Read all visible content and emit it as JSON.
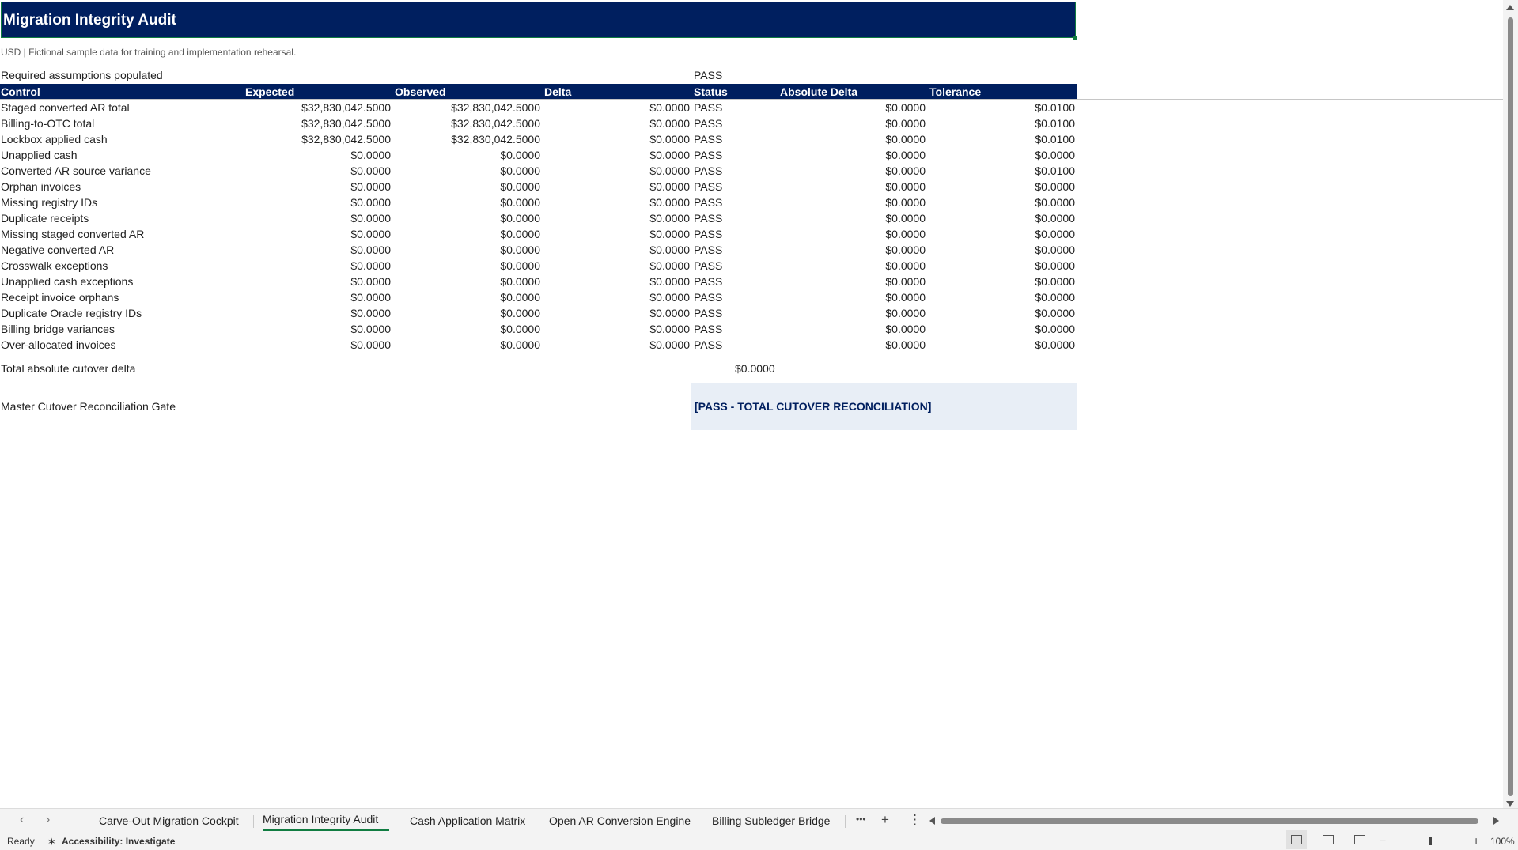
{
  "sheet": {
    "title": "Migration Integrity Audit",
    "note": "USD | Fictional sample data for training and implementation rehearsal.",
    "required": {
      "label": "Required assumptions populated",
      "value": "PASS"
    },
    "headers": [
      "Control",
      "Expected",
      "Observed",
      "Delta",
      "Status",
      "Absolute Delta",
      "Tolerance"
    ],
    "rows": [
      [
        "Staged converted AR total",
        "$32,830,042.5000",
        "$32,830,042.5000",
        "$0.0000",
        "PASS",
        "$0.0000",
        "$0.0100"
      ],
      [
        "Billing-to-OTC total",
        "$32,830,042.5000",
        "$32,830,042.5000",
        "$0.0000",
        "PASS",
        "$0.0000",
        "$0.0100"
      ],
      [
        "Lockbox applied cash",
        "$32,830,042.5000",
        "$32,830,042.5000",
        "$0.0000",
        "PASS",
        "$0.0000",
        "$0.0100"
      ],
      [
        "Unapplied cash",
        "$0.0000",
        "$0.0000",
        "$0.0000",
        "PASS",
        "$0.0000",
        "$0.0000"
      ],
      [
        "Converted AR source variance",
        "$0.0000",
        "$0.0000",
        "$0.0000",
        "PASS",
        "$0.0000",
        "$0.0100"
      ],
      [
        "Orphan invoices",
        "$0.0000",
        "$0.0000",
        "$0.0000",
        "PASS",
        "$0.0000",
        "$0.0000"
      ],
      [
        "Missing registry IDs",
        "$0.0000",
        "$0.0000",
        "$0.0000",
        "PASS",
        "$0.0000",
        "$0.0000"
      ],
      [
        "Duplicate receipts",
        "$0.0000",
        "$0.0000",
        "$0.0000",
        "PASS",
        "$0.0000",
        "$0.0000"
      ],
      [
        "Missing staged converted AR",
        "$0.0000",
        "$0.0000",
        "$0.0000",
        "PASS",
        "$0.0000",
        "$0.0000"
      ],
      [
        "Negative converted AR",
        "$0.0000",
        "$0.0000",
        "$0.0000",
        "PASS",
        "$0.0000",
        "$0.0000"
      ],
      [
        "Crosswalk exceptions",
        "$0.0000",
        "$0.0000",
        "$0.0000",
        "PASS",
        "$0.0000",
        "$0.0000"
      ],
      [
        "Unapplied cash exceptions",
        "$0.0000",
        "$0.0000",
        "$0.0000",
        "PASS",
        "$0.0000",
        "$0.0000"
      ],
      [
        "Receipt invoice orphans",
        "$0.0000",
        "$0.0000",
        "$0.0000",
        "PASS",
        "$0.0000",
        "$0.0000"
      ],
      [
        "Duplicate Oracle registry IDs",
        "$0.0000",
        "$0.0000",
        "$0.0000",
        "PASS",
        "$0.0000",
        "$0.0000"
      ],
      [
        "Billing bridge variances",
        "$0.0000",
        "$0.0000",
        "$0.0000",
        "PASS",
        "$0.0000",
        "$0.0000"
      ],
      [
        "Over-allocated invoices",
        "$0.0000",
        "$0.0000",
        "$0.0000",
        "PASS",
        "$0.0000",
        "$0.0000"
      ]
    ],
    "total": {
      "label": "Total absolute cutover delta",
      "value": "$0.0000"
    },
    "gate": {
      "label": "Master Cutover Reconciliation Gate",
      "value": "[PASS - TOTAL CUTOVER RECONCILIATION]"
    }
  },
  "tabs": {
    "items": [
      "Carve-Out Migration Cockpit",
      "Migration Integrity Audit",
      "Cash Application Matrix",
      "Open AR Conversion Engine",
      "Billing Subledger Bridge"
    ],
    "active_index": 1,
    "more": "•••",
    "add": "+",
    "options": "⋮"
  },
  "status": {
    "ready": "Ready",
    "accessibility": "Accessibility: Investigate",
    "zoom": "100%",
    "zoom_minus": "−",
    "zoom_plus": "+"
  },
  "colors": {
    "header_bg": "#001f5f",
    "accent": "#107c41",
    "gate_bg": "#e8eef6"
  }
}
